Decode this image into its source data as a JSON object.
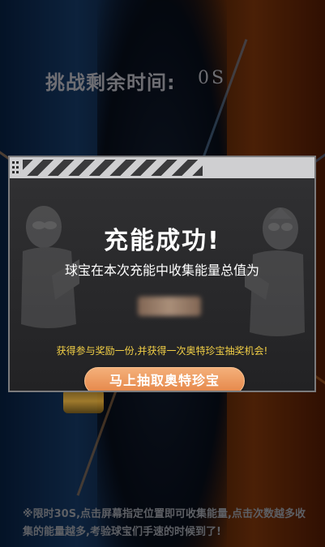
{
  "timer": {
    "label": "挑战剩余时间:",
    "value": "0S"
  },
  "modal": {
    "title": "充能成功!",
    "subtitle": "球宝在本次充能中收集能量总值为",
    "energy_value": "",
    "reward_text": "获得参与奖励一份,并获得一次奥特珍宝抽奖机会!",
    "draw_button_label": "马上抽取奥特珍宝"
  },
  "bottom_hint": "※限时30S,点击屏幕指定位置即可收集能量,点击次数越多收集的能量越多,考验球宝们手速的时候到了!",
  "colors": {
    "accent_orange": "#e58547",
    "reward_yellow": "#f3d046",
    "modal_bg": "#2b2b2d"
  }
}
